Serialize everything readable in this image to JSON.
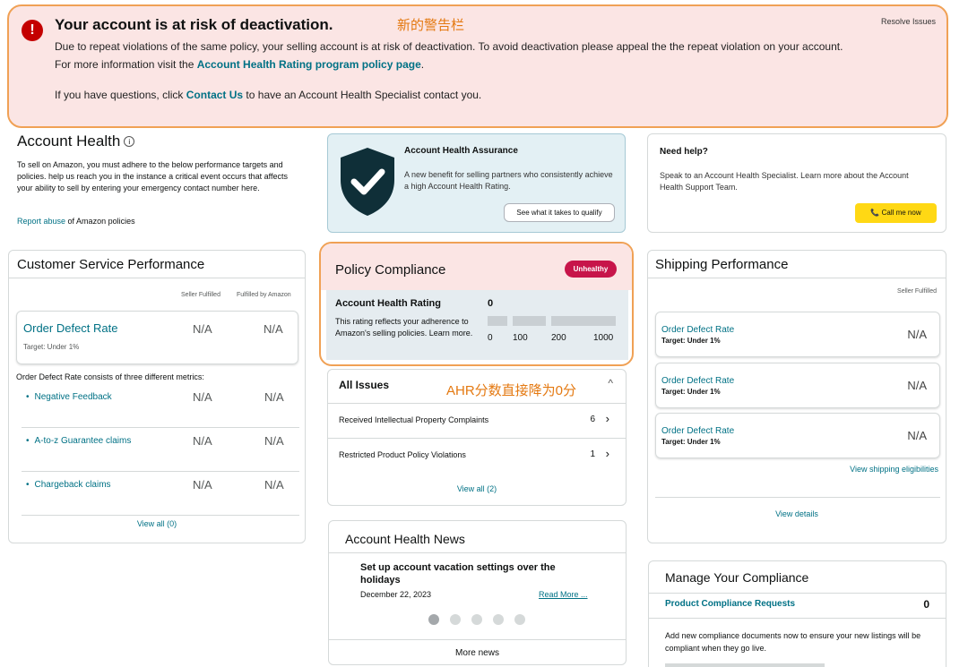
{
  "banner": {
    "title": "Your account is at risk of deactivation.",
    "annotation": "新的警告栏",
    "resolve": "Resolve Issues",
    "body_text": "Due to repeat violations of the same policy, your selling account is at risk of deactivation. To avoid deactivation please appeal the the repeat violation on your account. For more information visit the ",
    "body_link": "Account Health Rating program policy page",
    "body_end": ".",
    "q_text": "If you have questions, click ",
    "q_link": "Contact Us",
    "q_end": " to have an Account Health Specialist contact you."
  },
  "account_health": {
    "title": "Account Health",
    "info_icon": "i",
    "description": "To sell on Amazon, you must adhere to the below performance targets and policies. help us reach you in the instance a critical event occurs that affects your ability to sell by entering your emergency contact number here.",
    "report_link": "Report abuse",
    "report_rest": " of Amazon policies"
  },
  "csp": {
    "title": "Customer Service Performance",
    "col_seller": "Seller Fulfilled",
    "col_amazon": "Fulfilled by Amazon",
    "odr_label": "Order Defect Rate",
    "odr_target": "Target: Under 1%",
    "odr_v1": "N/A",
    "odr_v2": "N/A",
    "consists": "Order Defect Rate consists of three different metrics:",
    "metrics": [
      {
        "label": "Negative Feedback",
        "v1": "N/A",
        "v2": "N/A"
      },
      {
        "label": "A-to-z Guarantee claims",
        "v1": "N/A",
        "v2": "N/A"
      },
      {
        "label": "Chargeback claims",
        "v1": "N/A",
        "v2": "N/A"
      }
    ],
    "view_all": "View all (0)"
  },
  "aha": {
    "title": "Account Health Assurance",
    "desc": "A new benefit for selling partners who consistently achieve a high Account Health Rating.",
    "button": "See what it takes to qualify"
  },
  "help": {
    "title": "Need help?",
    "desc": "Speak to an Account Health Specialist. Learn more about the Account Health Support Team.",
    "button": "Call me now",
    "phone_icon": "📞"
  },
  "policy": {
    "title": "Policy Compliance",
    "badge": "Unhealthy",
    "ahr_label": "Account Health Rating",
    "ahr_value": "0",
    "ahr_desc": "This rating reflects your adherence to Amazon's selling policies. Learn more.",
    "ticks": [
      "0",
      "100",
      "200",
      "1000"
    ]
  },
  "annotation2": "AHR分数直接降为0分",
  "issues": {
    "title": "All Issues",
    "chevron": "^",
    "rows": [
      {
        "label": "Received Intellectual Property Complaints",
        "count": "6"
      },
      {
        "label": "Restricted Product Policy Violations",
        "count": "1"
      }
    ],
    "view_all": "View all (2)"
  },
  "news": {
    "title": "Account Health News",
    "headline": "Set up account vacation settings over the holidays",
    "date": "December 22, 2023",
    "read_more": "Read More ...",
    "more": "More news"
  },
  "shipping": {
    "title": "Shipping Performance",
    "col_seller": "Seller Fulfilled",
    "rows": [
      {
        "label": "Order Defect Rate",
        "target": "Target: Under 1%",
        "value": "N/A"
      },
      {
        "label": "Order Defect Rate",
        "target": "Target: Under 1%",
        "value": "N/A"
      },
      {
        "label": "Order Defect Rate",
        "target": "Target: Under 1%",
        "value": "N/A"
      }
    ],
    "eligibilities": "View shipping eligibilities",
    "details": "View details"
  },
  "manage": {
    "title": "Manage Your Compliance",
    "pcr_label": "Product Compliance Requests",
    "pcr_value": "0",
    "desc": "Add new compliance documents now to ensure your new listings will be compliant when they go live."
  },
  "colors": {
    "link": "#007185",
    "banner_bg": "#fbe5e4",
    "annotation_outline": "#f0a155",
    "unhealthy": "#c7154a",
    "call_button": "#ffd814"
  }
}
